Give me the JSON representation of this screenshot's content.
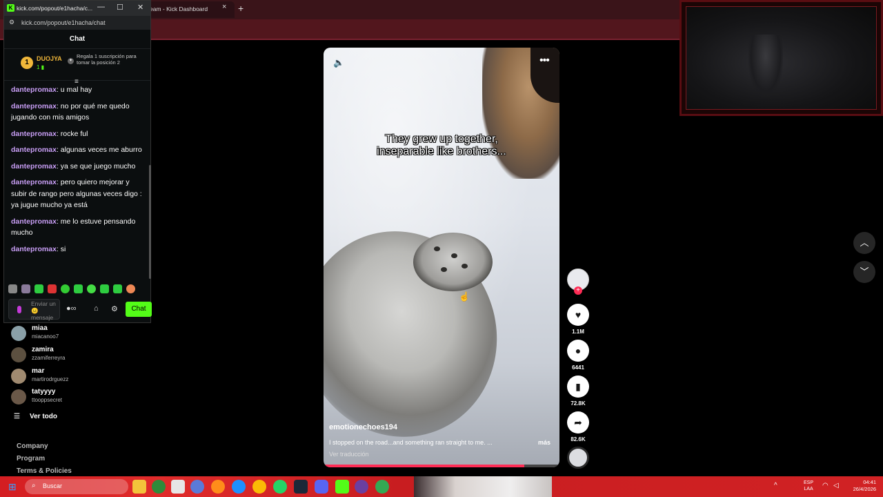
{
  "background_browser": {
    "tab_title": "eam - Kick Dashboard",
    "tab_close": "×",
    "new_tab": "+"
  },
  "popup": {
    "window_title": "kick.com/popout/e1hacha/c...",
    "favicon": "K",
    "controls": {
      "minimize": "—",
      "maximize": "☐",
      "close": "✕"
    },
    "url": "kick.com/popout/e1hacha/chat",
    "chat_header": "Chat",
    "leaderboard": {
      "rank": "1",
      "name": "DUOJYA",
      "count": "1",
      "message": "Regala 1 suscripción para tomar la posición 2"
    },
    "messages": [
      {
        "user": "dantepromax",
        "text": ": u mal hay"
      },
      {
        "user": "dantepromax",
        "text": ": no por qué me quedo jugando con mis amigos"
      },
      {
        "user": "dantepromax",
        "text": ": rocke ful"
      },
      {
        "user": "dantepromax",
        "text": ": algunas veces me aburro"
      },
      {
        "user": "dantepromax",
        "text": ": ya se que juego mucho"
      },
      {
        "user": "dantepromax",
        "text": ": pero quiero mejorar y subir de rango pero algunas veces digo : ya jugue mucho ya está"
      },
      {
        "user": "dantepromax",
        "text": ": me lo estuve pensando mucho"
      },
      {
        "user": "dantepromax",
        "text": ": si"
      }
    ],
    "input_placeholder": "Enviar un 😐 mensaje",
    "infinity": "∞",
    "chat_button": "Chat"
  },
  "sidebar": {
    "users": [
      {
        "name": "miaa",
        "handle": "miacanoo7"
      },
      {
        "name": "zamira",
        "handle": "zzamiferreyra"
      },
      {
        "name": "mar",
        "handle": "martirodrguezz"
      },
      {
        "name": "tatyyyy",
        "handle": "ttooppsecret"
      }
    ],
    "see_all": "Ver todo",
    "footer": [
      "Company",
      "Program",
      "Terms & Policies"
    ]
  },
  "video": {
    "caption_line1": "They grew up together,",
    "caption_line2": "inseparable like brothers...",
    "author": "emotionechoes194",
    "description": "I stopped on the road...and something ran straight to me. ...",
    "more": "más",
    "translate": "Ver traducción",
    "progress": 0.85
  },
  "actions": {
    "likes": "1.1M",
    "comments": "6441",
    "saves": "72.8K",
    "shares": "82.6K"
  },
  "taskbar": {
    "search": "Buscar",
    "language_line1": "ESP",
    "language_line2": "LAA",
    "time": "04:41",
    "date": "26/4/2026"
  },
  "colors": {
    "kick_green": "#53fc18",
    "username_purple": "#c89ef5",
    "like_red": "#fe2c55",
    "taskbar_red": "#d41e22"
  }
}
